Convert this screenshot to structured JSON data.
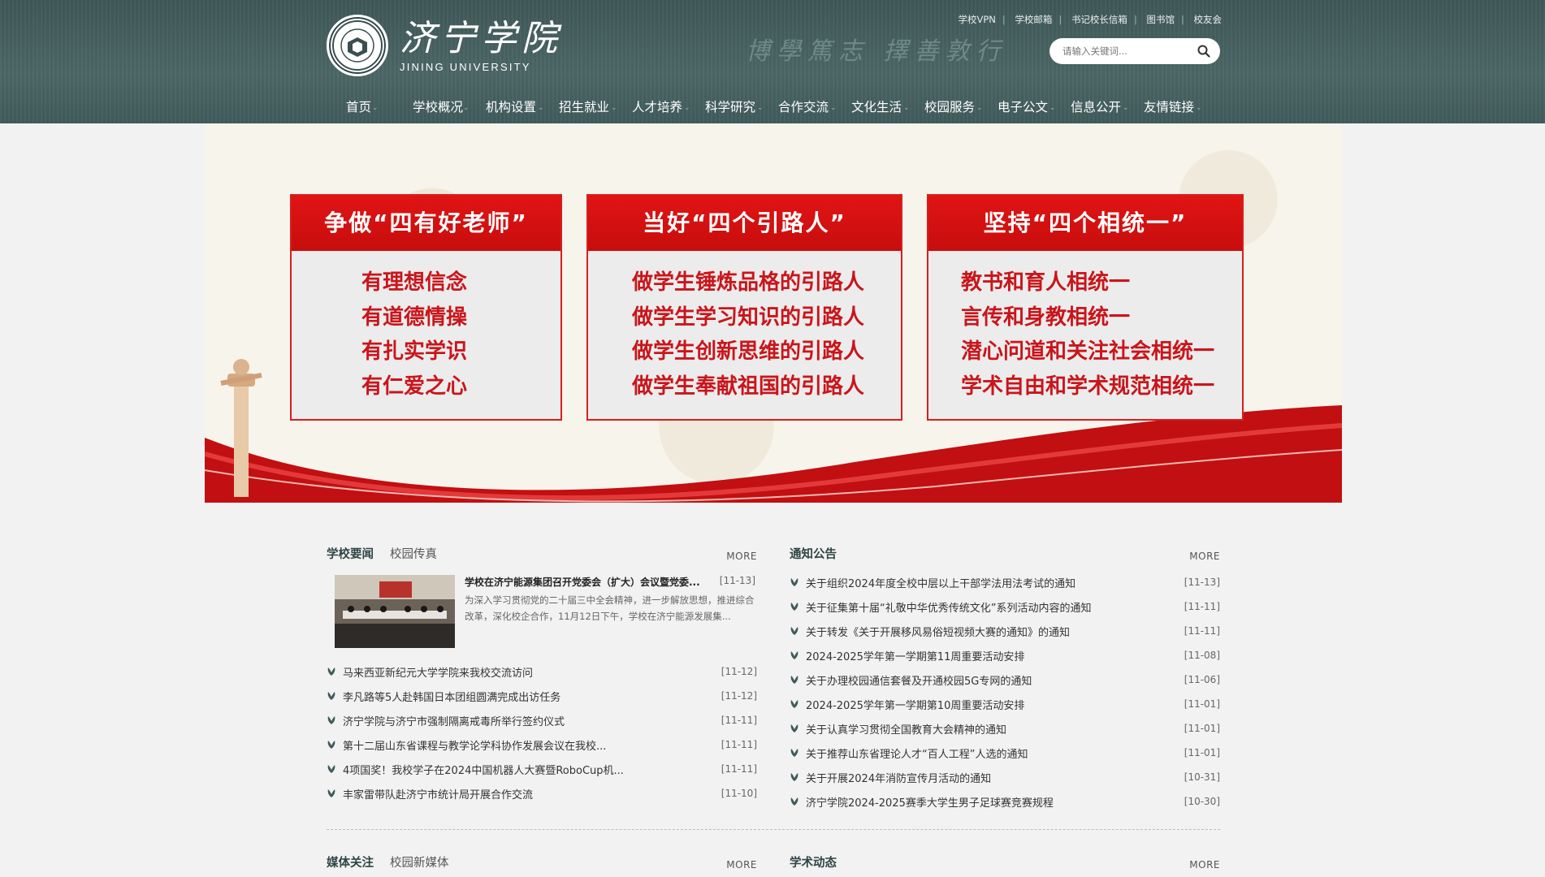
{
  "header": {
    "logo_cn": "济宁学院",
    "logo_en": "JINING UNIVERSITY",
    "motto": "博學篤志 擇善敦行",
    "top_links": [
      "学校VPN",
      "学校邮箱",
      "书记校长信箱",
      "图书馆",
      "校友会"
    ],
    "search_placeholder": "请输入关键词..."
  },
  "nav": [
    "首页",
    "学校概况",
    "机构设置",
    "招生就业",
    "人才培养",
    "科学研究",
    "合作交流",
    "文化生活",
    "校园服务",
    "电子公文",
    "信息公开",
    "友情链接"
  ],
  "banner": {
    "cards": [
      {
        "title": "争做“四有好老师”",
        "lines": [
          "有理想信念",
          "有道德情操",
          "有扎实学识",
          "有仁爱之心"
        ]
      },
      {
        "title": "当好“四个引路人”",
        "lines": [
          "做学生锤炼品格的引路人",
          "做学生学习知识的引路人",
          "做学生创新思维的引路人",
          "做学生奉献祖国的引路人"
        ]
      },
      {
        "title": "坚持“四个相统一”",
        "lines": [
          "教书和育人相统一",
          "言传和身教相统一",
          "潜心问道和关注社会相统一",
          "学术自由和学术规范相统一"
        ]
      }
    ]
  },
  "news": {
    "tab_active": "学校要闻",
    "tab_other": "校园传真",
    "more": "MORE",
    "featured": {
      "title": "学校在济宁能源集团召开党委会（扩大）会议暨党委...",
      "date": "[11-13]",
      "desc": "为深入学习贯彻党的二十届三中全会精神，进一步解放思想，推进综合改革，深化校企合作，11月12日下午，学校在济宁能源发展集..."
    },
    "items": [
      {
        "text": "马来西亚新纪元大学学院来我校交流访问",
        "date": "[11-12]"
      },
      {
        "text": "李凡路等5人赴韩国日本团组圆满完成出访任务",
        "date": "[11-12]"
      },
      {
        "text": "济宁学院与济宁市强制隔离戒毒所举行签约仪式",
        "date": "[11-11]"
      },
      {
        "text": "第十二届山东省课程与教学论学科协作发展会议在我校...",
        "date": "[11-11]"
      },
      {
        "text": "4项国奖！我校学子在2024中国机器人大赛暨RoboCup机...",
        "date": "[11-11]"
      },
      {
        "text": "丰家雷带队赴济宁市统计局开展合作交流",
        "date": "[11-10]"
      }
    ]
  },
  "notices": {
    "tab_active": "通知公告",
    "more": "MORE",
    "items": [
      {
        "text": "关于组织2024年度全校中层以上干部学法用法考试的通知",
        "date": "[11-13]"
      },
      {
        "text": "关于征集第十届“礼敬中华优秀传统文化”系列活动内容的通知",
        "date": "[11-11]"
      },
      {
        "text": "关于转发《关于开展移风易俗短视频大赛的通知》的通知",
        "date": "[11-11]"
      },
      {
        "text": "2024-2025学年第一学期第11周重要活动安排",
        "date": "[11-08]"
      },
      {
        "text": "关于办理校园通信套餐及开通校园5G专网的通知",
        "date": "[11-06]"
      },
      {
        "text": "2024-2025学年第一学期第10周重要活动安排",
        "date": "[11-01]"
      },
      {
        "text": "关于认真学习贯彻全国教育大会精神的通知",
        "date": "[11-01]"
      },
      {
        "text": "关于推荐山东省理论人才“百人工程”人选的通知",
        "date": "[11-01]"
      },
      {
        "text": "关于开展2024年消防宣传月活动的通知",
        "date": "[10-31]"
      },
      {
        "text": "济宁学院2024-2025赛季大学生男子足球赛竞赛规程",
        "date": "[10-30]"
      }
    ]
  },
  "media": {
    "tab_active": "媒体关注",
    "tab_other": "校园新媒体",
    "more": "MORE"
  },
  "academic": {
    "tab_active": "学术动态",
    "more": "MORE"
  },
  "colors": {
    "header_bg": "#4a6464",
    "accent_red": "#d81e1e",
    "banner_text_red": "#c9151b"
  }
}
